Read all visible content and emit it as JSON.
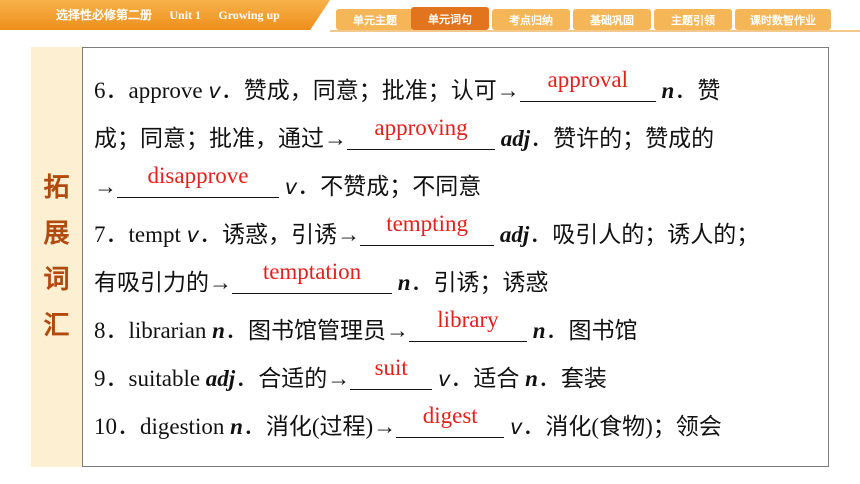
{
  "header": {
    "book": "选择性必修第二册",
    "unit": "Unit 1",
    "topic": "Growing up",
    "tabs": [
      "单元主题",
      "单元词句",
      "考点归纳",
      "基础巩固",
      "主题引领",
      "课时数智作业"
    ]
  },
  "side_label": [
    "拓",
    "展",
    "词",
    "汇"
  ],
  "lines": {
    "l1": {
      "pre": "6．approve ",
      "pos": "v",
      "mid": "．赞成，同意；批准；认可→",
      "answer": "approval",
      "pos2": "n",
      "post": "．赞"
    },
    "l2": {
      "pre": "成；同意；批准，通过→",
      "answer": "approving",
      "pos": "adj",
      "post": "．赞许的；赞成的"
    },
    "l3": {
      "pre": "→",
      "answer": "disapprove",
      "pos": "v",
      "post": "．不赞成；不同意"
    },
    "l4": {
      "pre": "7．tempt ",
      "pos": "v",
      "mid": "．诱惑，引诱→",
      "answer": "tempting",
      "pos2": "adj",
      "post": "．吸引人的；诱人的；"
    },
    "l5": {
      "pre": "有吸引力的→",
      "answer": "temptation",
      "pos": "n",
      "post": "．引诱；诱惑"
    },
    "l6": {
      "pre": "8．librarian ",
      "pos": "n",
      "mid": "．图书馆管理员→",
      "answer": "library",
      "pos2": "n",
      "post": "．图书馆"
    },
    "l7": {
      "pre": "9．suitable ",
      "pos": "adj",
      "mid": "．合适的→",
      "answer": "suit",
      "pos2": "v",
      "mid2": "．适合 ",
      "pos3": "n",
      "post": "．套装"
    },
    "l8": {
      "pre": "10．digestion ",
      "pos": "n",
      "mid": "．消化(过程)→",
      "answer": "digest",
      "pos2": "v",
      "post": "．消化(食物)；领会"
    }
  }
}
